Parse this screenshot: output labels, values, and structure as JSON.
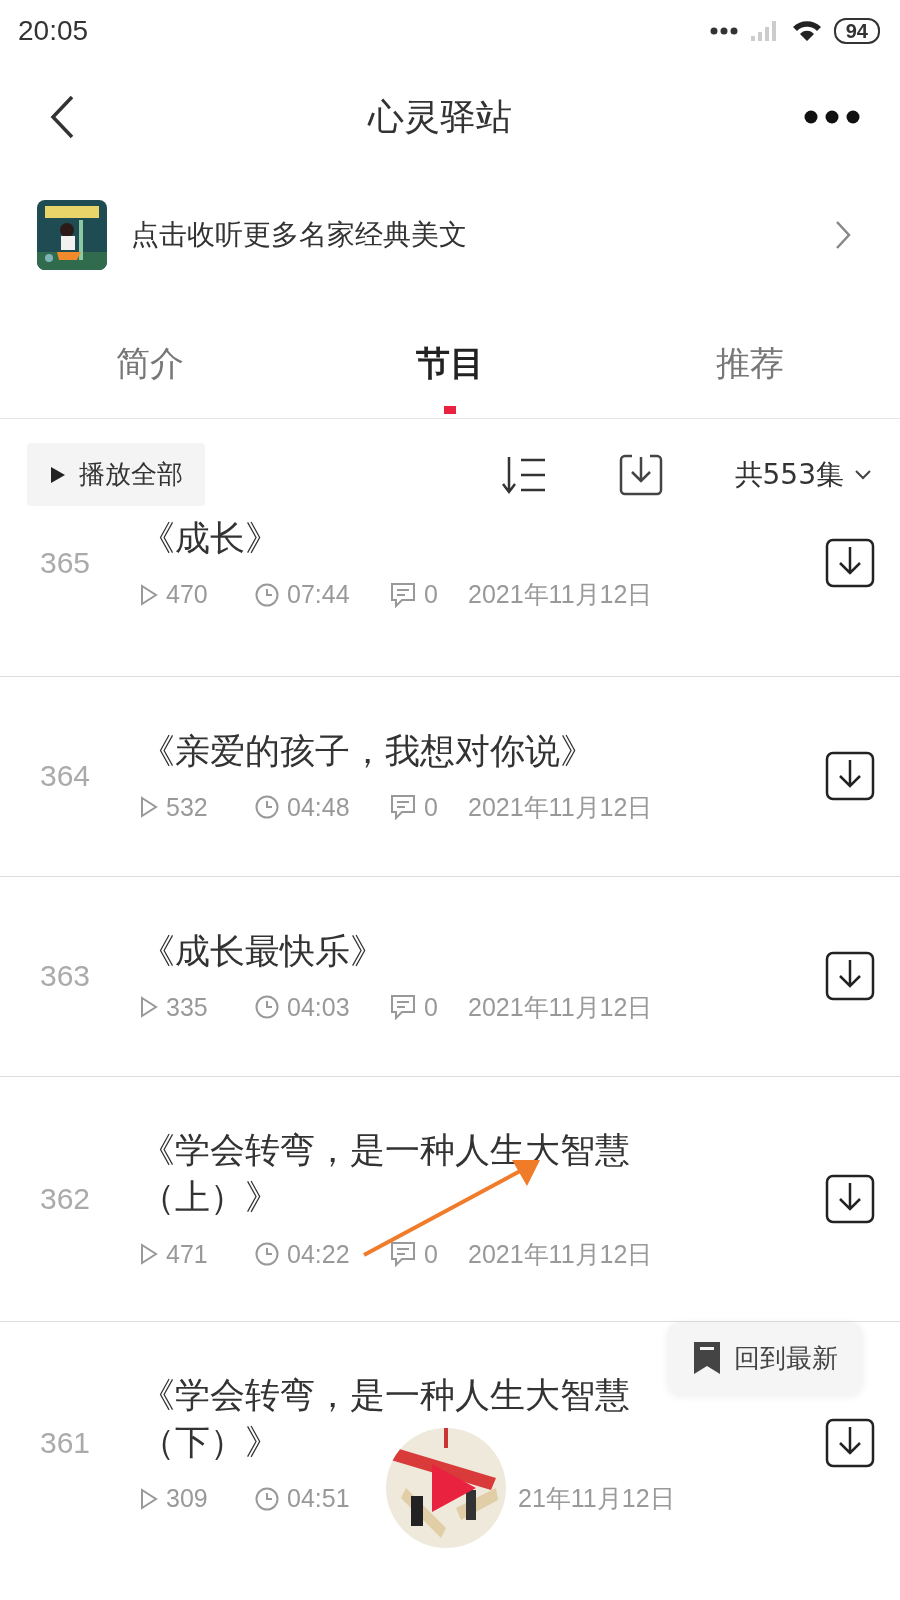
{
  "status_bar": {
    "time": "20:05",
    "battery": "94"
  },
  "header": {
    "title": "心灵驿站"
  },
  "banner": {
    "text": "点击收听更多名家经典美文"
  },
  "tabs": [
    {
      "label": "简介",
      "selected": false
    },
    {
      "label": "节目",
      "selected": true
    },
    {
      "label": "推荐",
      "selected": false
    }
  ],
  "toolbar": {
    "play_all": "播放全部",
    "episode_count": "共553集"
  },
  "episodes": [
    {
      "number": "365",
      "title": "《成长》",
      "plays": "470",
      "duration": "07:44",
      "comments": "0",
      "date": "2021年11月12日"
    },
    {
      "number": "364",
      "title": "《亲爱的孩子，我想对你说》",
      "plays": "532",
      "duration": "04:48",
      "comments": "0",
      "date": "2021年11月12日"
    },
    {
      "number": "363",
      "title": "《成长最快乐》",
      "plays": "335",
      "duration": "04:03",
      "comments": "0",
      "date": "2021年11月12日"
    },
    {
      "number": "362",
      "title": "《学会转弯，是一种人生大智慧（上）》",
      "plays": "471",
      "duration": "04:22",
      "comments": "0",
      "date": "2021年11月12日"
    },
    {
      "number": "361",
      "title": "《学会转弯，是一种人生大智慧（下）》",
      "plays": "309",
      "duration": "04:51",
      "date": "21年11月12日"
    }
  ],
  "back_to_latest": "回到最新"
}
